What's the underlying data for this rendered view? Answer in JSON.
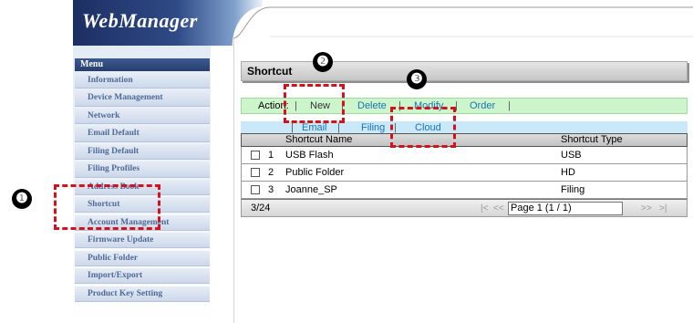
{
  "header": {
    "logo_text": "WebManager"
  },
  "sidebar": {
    "title": "Menu",
    "items": [
      "Information",
      "Device Management",
      "Network",
      "Email Default",
      "Filing Default",
      "Filing Profiles",
      "Address Book",
      "Shortcut",
      "Account Management",
      "Firmware Update",
      "Public Folder",
      "Import/Export",
      "Product Key Setting"
    ]
  },
  "main": {
    "title": "Shortcut",
    "action_bar": {
      "label": "Action:",
      "new": "New",
      "delete": "Delete",
      "modify": "Modify",
      "order": "Order",
      "separator": "|"
    },
    "filter_bar": {
      "email": "Email",
      "filing": "Filing",
      "cloud": "Cloud"
    },
    "table": {
      "columns": [
        "Shortcut Name",
        "Shortcut Type"
      ],
      "rows": [
        {
          "index": "1",
          "name": "USB Flash",
          "type": "USB"
        },
        {
          "index": "2",
          "name": "Public Folder",
          "type": "HD"
        },
        {
          "index": "3",
          "name": "Joanne_SP",
          "type": "Filing"
        }
      ]
    },
    "pager": {
      "count": "3/24",
      "first": "|<",
      "prev": "<<",
      "page": "Page 1 (1 / 1)",
      "next": ">>",
      "last": ">|"
    }
  },
  "annotations": {
    "badge1": "❶",
    "badge2": "❷",
    "badge3": "❸"
  },
  "colors": {
    "highlight": "#d4121c",
    "action_bar": "#ccf5cc",
    "filter_bar": "#c9e8f8",
    "menu_text": "#4f6a98"
  }
}
